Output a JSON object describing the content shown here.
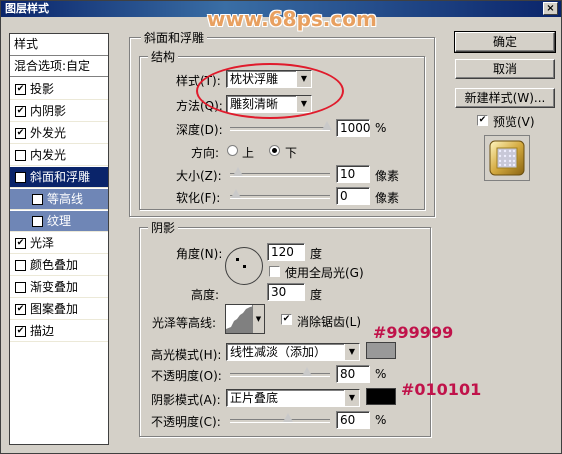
{
  "window": {
    "title": "图层样式",
    "close_glyph": "×"
  },
  "watermark": "www.68ps.com",
  "left_panel": {
    "header": "样式",
    "blend": "混合选项:自定",
    "items": [
      {
        "label": "投影",
        "checked": "✔"
      },
      {
        "label": "内阴影",
        "checked": "✔"
      },
      {
        "label": "外发光",
        "checked": "✔"
      },
      {
        "label": "内发光",
        "checked": ""
      },
      {
        "label": "斜面和浮雕",
        "checked": "✔"
      },
      {
        "label": "等高线",
        "checked": "✔"
      },
      {
        "label": "纹理",
        "checked": ""
      },
      {
        "label": "光泽",
        "checked": "✔"
      },
      {
        "label": "颜色叠加",
        "checked": ""
      },
      {
        "label": "渐变叠加",
        "checked": ""
      },
      {
        "label": "图案叠加",
        "checked": "✔"
      },
      {
        "label": "描边",
        "checked": "✔"
      }
    ]
  },
  "bevel": {
    "group_title": "斜面和浮雕",
    "structure_title": "结构",
    "style_label": "样式(T):",
    "style_value": "枕状浮雕",
    "technique_label": "方法(Q):",
    "technique_value": "雕刻清晰",
    "depth_label": "深度(D):",
    "depth_value": "1000",
    "depth_unit": "%",
    "direction_label": "方向:",
    "dir_up": "上",
    "dir_down": "下",
    "size_label": "大小(Z):",
    "size_value": "10",
    "size_unit": "像素",
    "soften_label": "软化(F):",
    "soften_value": "0",
    "soften_unit": "像素"
  },
  "shading": {
    "group_title": "阴影",
    "angle_label": "角度(N):",
    "angle_value": "120",
    "angle_unit": "度",
    "global_light_label": "使用全局光(G)",
    "altitude_label": "高度:",
    "altitude_value": "30",
    "altitude_unit": "度",
    "gloss_label": "光泽等高线:",
    "antialias_label": "消除锯齿(L)",
    "highlight_label": "高光模式(H):",
    "highlight_mode": "线性减淡（添加）",
    "highlight_color": "#999999",
    "hl_opacity_label": "不透明度(O):",
    "hl_opacity_value": "80",
    "hl_opacity_unit": "%",
    "shadow_label": "阴影模式(A):",
    "shadow_mode": "正片叠底",
    "shadow_color": "#010101",
    "sh_opacity_label": "不透明度(C):",
    "sh_opacity_value": "60",
    "sh_opacity_unit": "%"
  },
  "buttons": {
    "ok": "确定",
    "cancel": "取消",
    "new_style": "新建样式(W)...",
    "preview": "预览(V)"
  },
  "annotations": {
    "highlight": "#999999",
    "shadow": "#010101"
  }
}
